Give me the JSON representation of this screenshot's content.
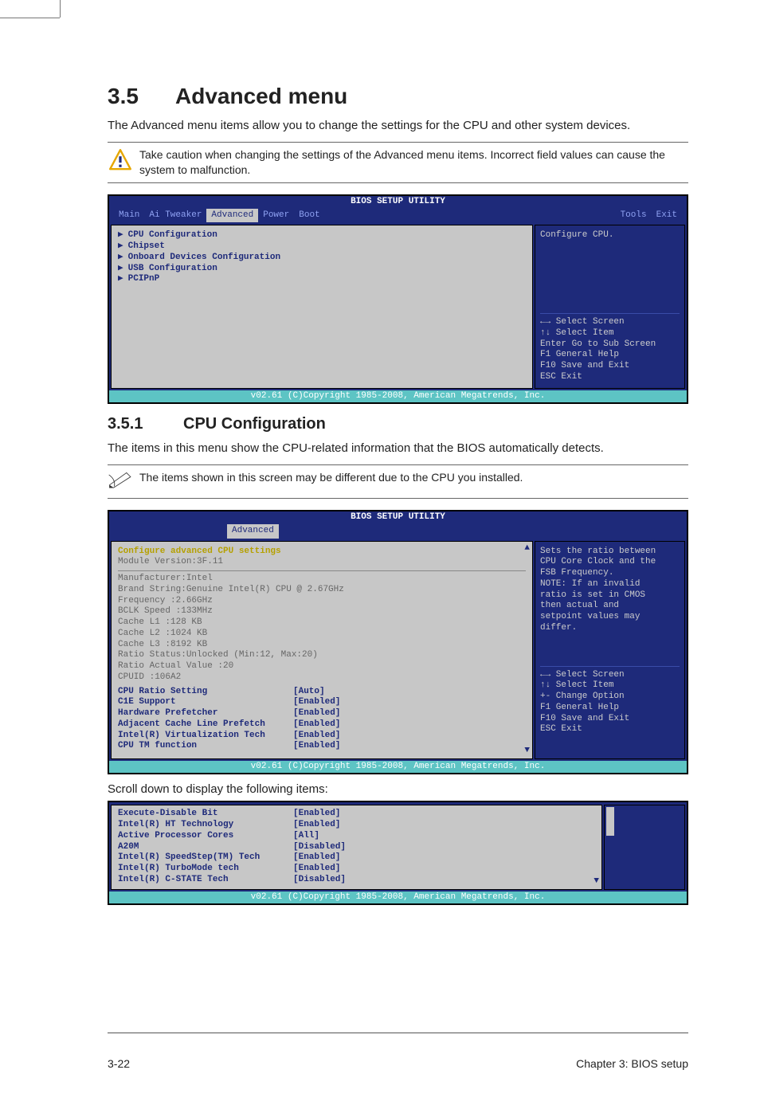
{
  "section": {
    "number": "3.5",
    "title": "Advanced menu"
  },
  "intro": "The Advanced menu items allow you to change the settings for the CPU and other system devices.",
  "warning": "Take caution when changing the settings of the Advanced menu items. Incorrect field values can cause the system to malfunction.",
  "bios1": {
    "title": "BIOS SETUP UTILITY",
    "menubar": [
      "Main",
      "Ai Tweaker",
      "Advanced",
      "Power",
      "Boot",
      "Tools",
      "Exit"
    ],
    "active_tab": "Advanced",
    "items": [
      "CPU Configuration",
      "Chipset",
      "Onboard Devices Configuration",
      "USB Configuration",
      "PCIPnP"
    ],
    "help_top": "Configure CPU.",
    "help_nav": {
      "lr": "←→   Select Screen",
      "ud": "↑↓   Select Item",
      "enter": "Enter Go to Sub Screen",
      "f1": "F1   General Help",
      "f10": "F10  Save and Exit",
      "esc": "ESC  Exit"
    },
    "footer": "v02.61 (C)Copyright 1985-2008, American Megatrends, Inc."
  },
  "subsection": {
    "number": "3.5.1",
    "title": "CPU Configuration"
  },
  "sub_intro": "The items in this menu show the CPU-related information that the BIOS automatically detects.",
  "note": "The items shown in this screen may be different due to the CPU you installed.",
  "bios2": {
    "title": "BIOS SETUP UTILITY",
    "tab": "Advanced",
    "header": "Configure advanced CPU settings",
    "module": "Module Version:3F.11",
    "info": [
      "Manufacturer:Intel",
      "Brand String:Genuine Intel(R) CPU @ 2.67GHz",
      "Frequency   :2.66GHz",
      "BCLK Speed  :133MHz",
      "Cache L1    :128 KB",
      "Cache L2    :1024 KB",
      "Cache L3    :8192 KB",
      "Ratio Status:Unlocked (Min:12, Max:20)",
      "Ratio Actual Value  :20",
      "CPUID       :106A2"
    ],
    "settings": [
      {
        "lbl": "CPU Ratio Setting",
        "val": "[Auto]"
      },
      {
        "lbl": "C1E Support",
        "val": "[Enabled]"
      },
      {
        "lbl": "Hardware Prefetcher",
        "val": "[Enabled]"
      },
      {
        "lbl": "Adjacent Cache Line Prefetch",
        "val": "[Enabled]"
      },
      {
        "lbl": "Intel(R) Virtualization Tech",
        "val": "[Enabled]"
      },
      {
        "lbl": "CPU TM function",
        "val": "[Enabled]"
      }
    ],
    "help_top": [
      "Sets the ratio between",
      "CPU Core Clock and the",
      "FSB Frequency.",
      "NOTE: If an invalid",
      "ratio is set in CMOS",
      "then actual and",
      "setpoint values may",
      "differ."
    ],
    "help_nav": {
      "lr": "←→   Select Screen",
      "ud": "↑↓   Select Item",
      "pm": "+-    Change Option",
      "f1": "F1   General Help",
      "f10": "F10  Save and Exit",
      "esc": "ESC  Exit"
    },
    "footer": "v02.61 (C)Copyright 1985-2008, American Megatrends, Inc."
  },
  "scroll_caption": "Scroll down to display the following items:",
  "bios3": {
    "settings": [
      {
        "lbl": "Execute-Disable Bit",
        "val": "[Enabled]"
      },
      {
        "lbl": "Intel(R) HT Technology",
        "val": "[Enabled]"
      },
      {
        "lbl": "Active Processor Cores",
        "val": "[All]"
      },
      {
        "lbl": "A20M",
        "val": "[Disabled]"
      },
      {
        "lbl": "Intel(R) SpeedStep(TM) Tech",
        "val": "[Enabled]"
      },
      {
        "lbl": "Intel(R) TurboMode tech",
        "val": "[Enabled]"
      },
      {
        "lbl": "Intel(R) C-STATE Tech",
        "val": "[Disabled]"
      }
    ],
    "footer": "v02.61 (C)Copyright 1985-2008, American Megatrends, Inc."
  },
  "page_footer": {
    "left": "3-22",
    "right": "Chapter 3: BIOS setup"
  }
}
